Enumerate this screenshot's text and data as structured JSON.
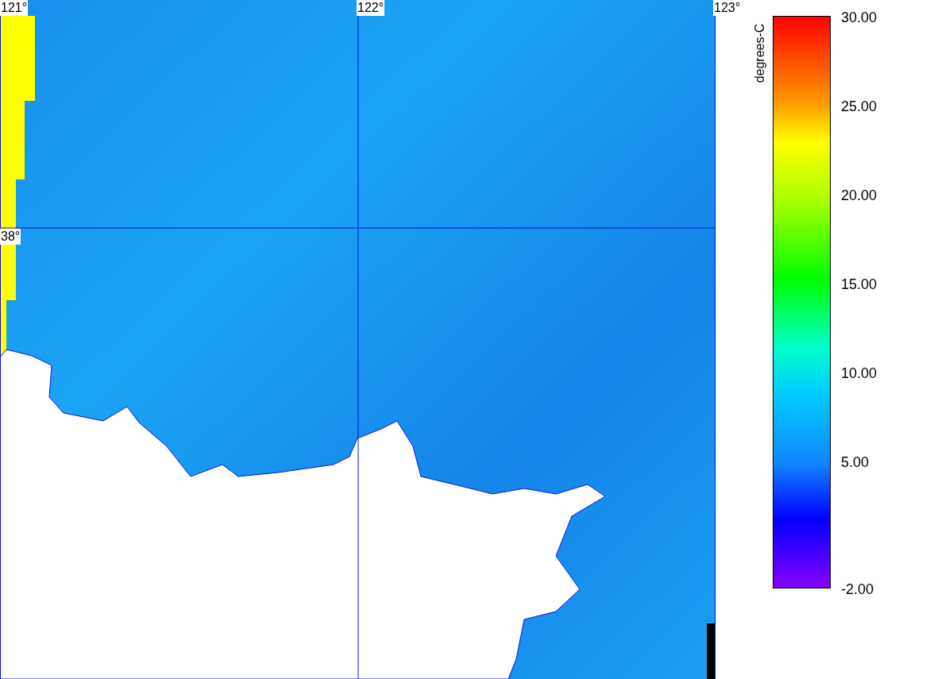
{
  "map": {
    "lon_labels": [
      "121°",
      "122°",
      "123°"
    ],
    "lat_labels": [
      "38°"
    ]
  },
  "legend": {
    "title": "degrees-C",
    "ticks": [
      "30.00",
      "25.00",
      "20.00",
      "15.00",
      "10.00",
      "5.00",
      "-2.00"
    ]
  }
}
